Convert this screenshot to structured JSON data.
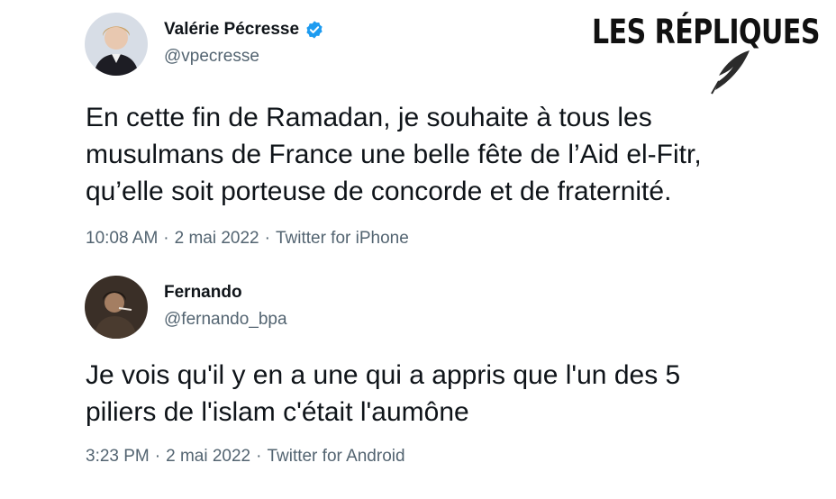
{
  "brand": {
    "logo_text": "LES RÉPLIQUES",
    "logo_icon": "quill-icon"
  },
  "tweets": [
    {
      "author_name": "Valérie Pécresse",
      "author_handle": "@vpecresse",
      "verified": true,
      "verified_color": "#1d9bf0",
      "text": "En cette fin de Ramadan, je souhaite à tous les\nmusulmans de France une belle fête de l’Aid el-Fitr,\nqu’elle soit porteuse de concorde et de fraternité.",
      "time": "10:08 AM",
      "date": "2 mai 2022",
      "source": "Twitter for iPhone"
    },
    {
      "author_name": "Fernando",
      "author_handle": "@fernando_bpa",
      "verified": false,
      "text": "Je vois qu'il y en a une qui a appris que l'un des 5\npiliers de l'islam c'était l'aumône",
      "time": "3:23 PM",
      "date": "2 mai 2022",
      "source": "Twitter for Android"
    }
  ],
  "separator": "·"
}
